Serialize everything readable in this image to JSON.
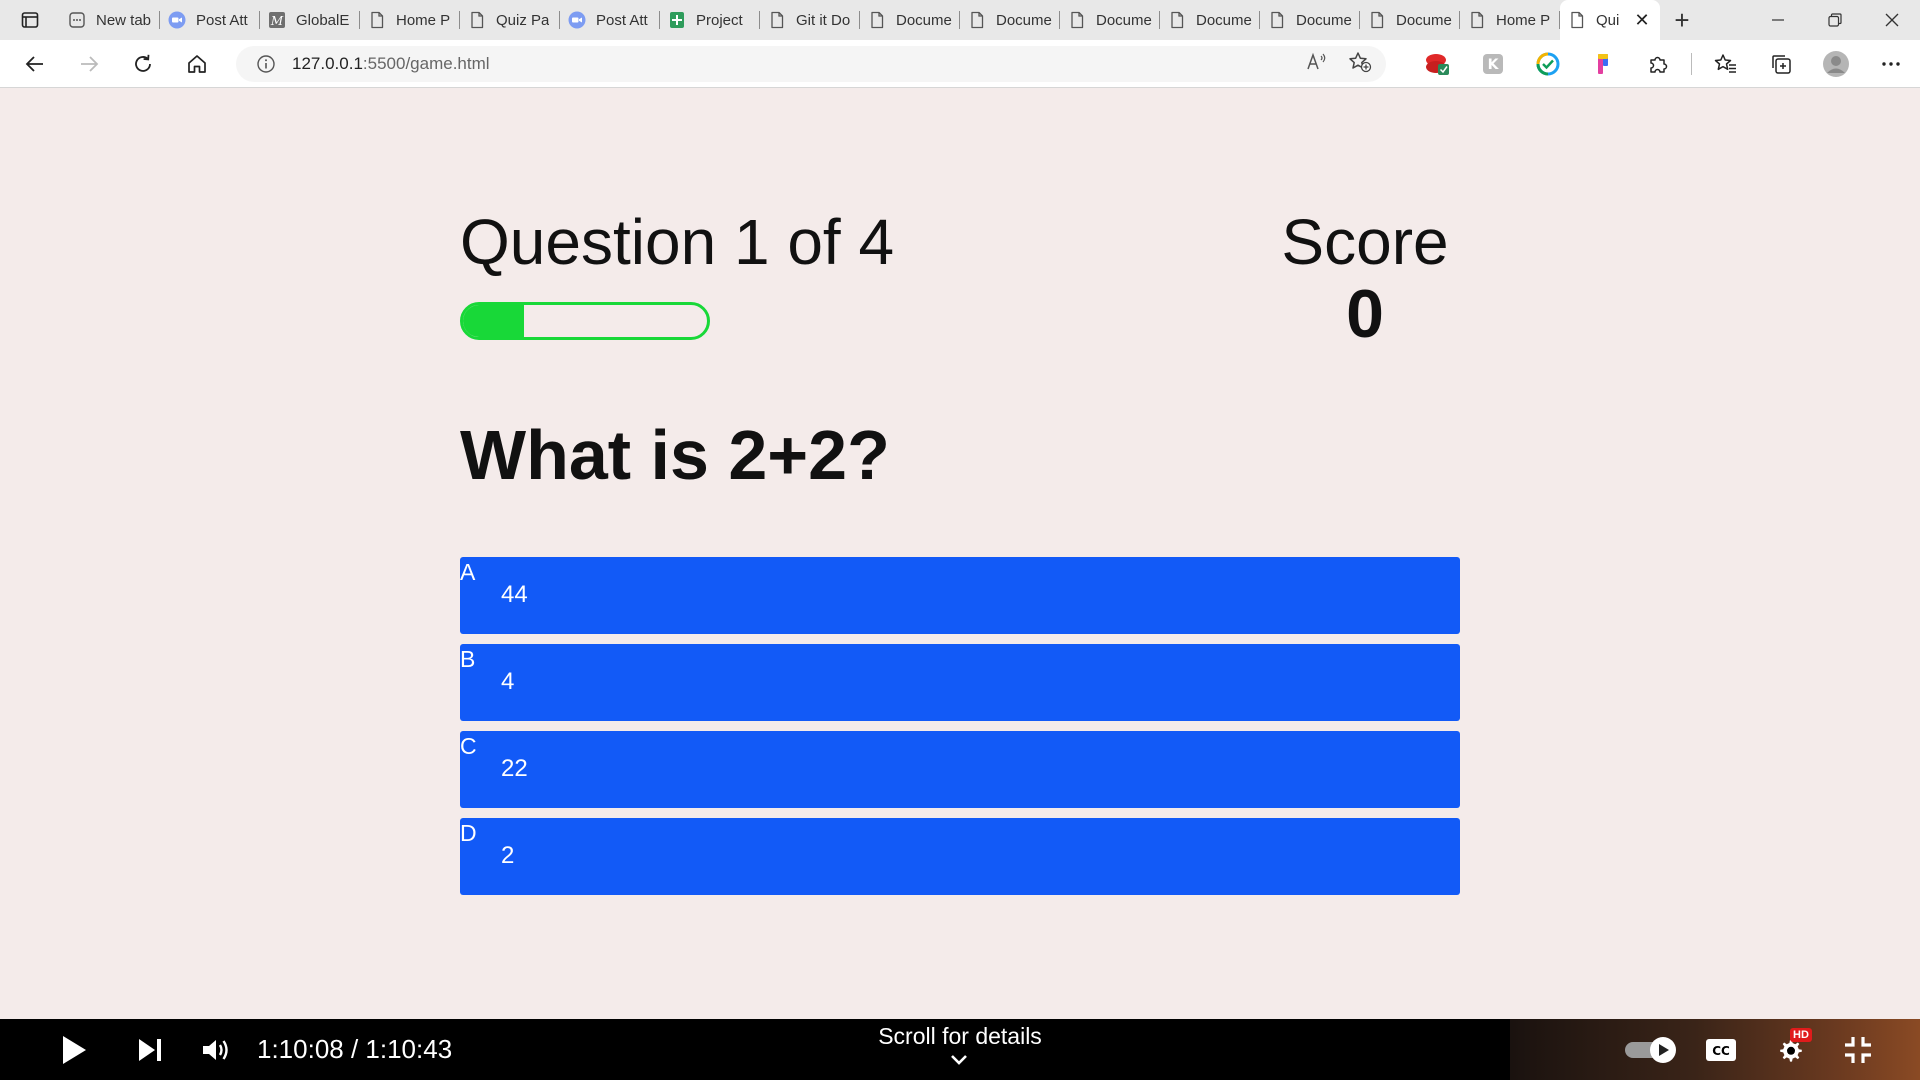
{
  "browser": {
    "tabs": [
      {
        "title": "New tab",
        "icon": "newtab-icon"
      },
      {
        "title": "Post Att",
        "icon": "zoom-video-icon"
      },
      {
        "title": "GlobalE",
        "icon": "m-logo-icon"
      },
      {
        "title": "Home P",
        "icon": "page-icon"
      },
      {
        "title": "Quiz Pa",
        "icon": "page-icon"
      },
      {
        "title": "Post Att",
        "icon": "zoom-video-icon"
      },
      {
        "title": "Project",
        "icon": "sheets-icon"
      },
      {
        "title": "Git it Do",
        "icon": "page-icon"
      },
      {
        "title": "Docume",
        "icon": "page-icon"
      },
      {
        "title": "Docume",
        "icon": "page-icon"
      },
      {
        "title": "Docume",
        "icon": "page-icon"
      },
      {
        "title": "Docume",
        "icon": "page-icon"
      },
      {
        "title": "Docume",
        "icon": "page-icon"
      },
      {
        "title": "Docume",
        "icon": "page-icon"
      },
      {
        "title": "Home P",
        "icon": "page-icon"
      }
    ],
    "active_tab": {
      "title": "Qui",
      "icon": "page-icon",
      "close": "✕"
    },
    "new_tab_label": "+",
    "url_host": "127.0.0.1",
    "url_rest": ":5500/game.html"
  },
  "game": {
    "progress_text": "Question 1 of 4",
    "progress_fraction": 0.25,
    "score_label": "Score",
    "score_value": "0",
    "question": "What is 2+2?",
    "choices": [
      {
        "prefix": "A",
        "text": "44"
      },
      {
        "prefix": "B",
        "text": "4"
      },
      {
        "prefix": "C",
        "text": "22"
      },
      {
        "prefix": "D",
        "text": "2"
      }
    ],
    "choice_color": "#125af7",
    "progress_color": "#18d838"
  },
  "player": {
    "time": "1:10:08 / 1:10:43",
    "scroll_hint": "Scroll for details",
    "hd_badge": "HD"
  }
}
